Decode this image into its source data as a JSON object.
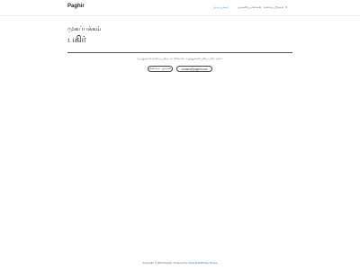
{
  "header": {
    "brand": "Paghir",
    "nav": [
      {
        "label": "முகப்பக்கம்",
        "active": true
      },
      {
        "label": "பங்களிப்பாளர்கள்",
        "active": false
      },
      {
        "label": "வகைப்படுத்தல்",
        "active": false,
        "has_dropdown": true
      }
    ]
  },
  "main": {
    "breadcrumb": "முகப்பக்கம்",
    "title": "பகிர்",
    "description": "பொதுவான வலைப்பதிவு. கட்டுரைகள், கருத்துக்கள் பகிரப்படும் தளம்.",
    "buttons": {
      "follow": "பின்தொடருங்கள்",
      "email": "contact@paghir.com"
    }
  },
  "footer": {
    "prefix": "Copyright © 2023 Paghir. Powered by ",
    "theme_link": "Astra WordPress Theme"
  },
  "colors": {
    "accent": "#1a73c8",
    "rule": "#555555"
  }
}
